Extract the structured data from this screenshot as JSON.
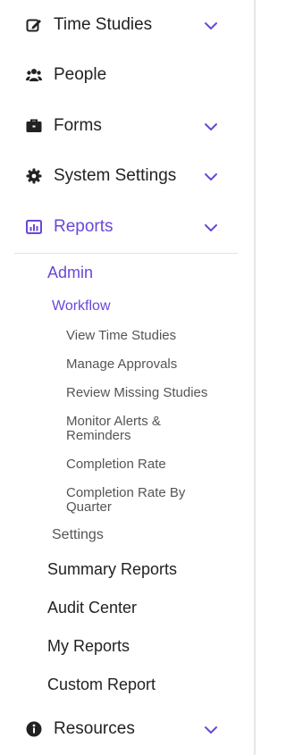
{
  "theme": {
    "accent": "#6a47d8",
    "text": "#222222",
    "muted": "#555555"
  },
  "nav": {
    "time_studies": {
      "label": "Time Studies",
      "icon": "edit-icon"
    },
    "people": {
      "label": "People",
      "icon": "users-icon"
    },
    "forms": {
      "label": "Forms",
      "icon": "briefcase-icon"
    },
    "system_settings": {
      "label": "System Settings",
      "icon": "gear-icon"
    },
    "reports": {
      "label": "Reports",
      "icon": "bar-chart-icon"
    },
    "resources": {
      "label": "Resources",
      "icon": "info-icon"
    }
  },
  "reports_menu": {
    "admin": "Admin",
    "workflow": "Workflow",
    "workflow_items": [
      "View Time Studies",
      "Manage Approvals",
      "Review Missing Studies",
      "Monitor Alerts & Reminders",
      "Completion Rate",
      "Completion Rate By Quarter"
    ],
    "settings": "Settings",
    "other_reports": [
      "Summary Reports",
      "Audit Center",
      "My Reports",
      "Custom Report"
    ]
  }
}
